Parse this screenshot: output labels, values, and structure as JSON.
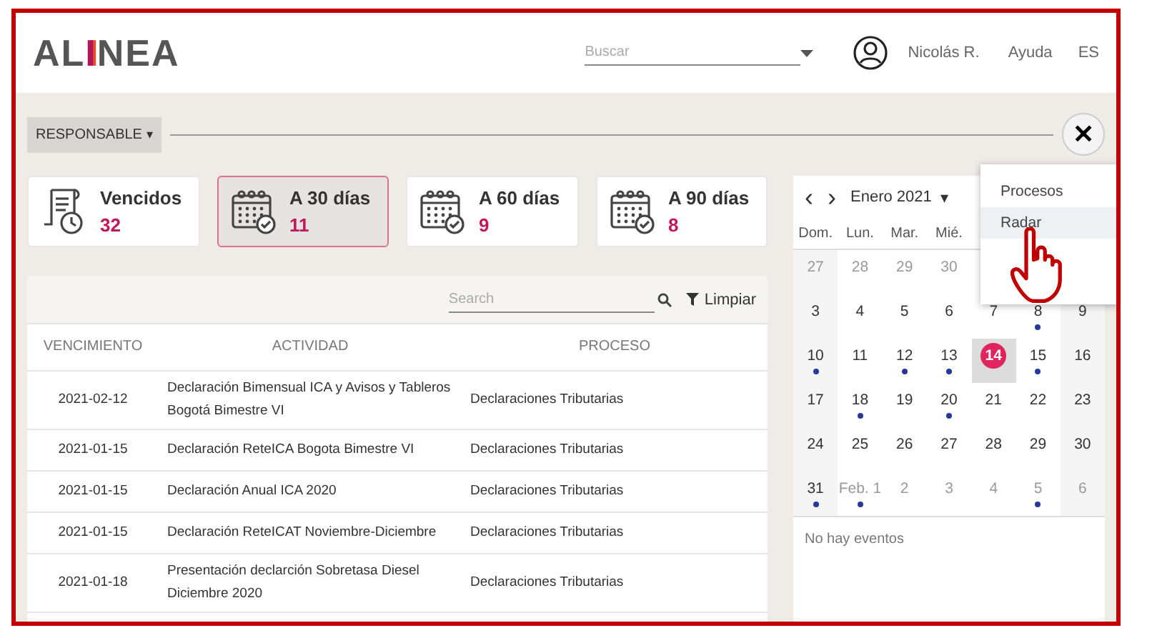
{
  "header": {
    "logo": {
      "before": "AL",
      "mark": "I",
      "after": "NEA"
    },
    "search": {
      "placeholder": "Buscar"
    },
    "user": "Nicolás R.",
    "help": "Ayuda",
    "language": "ES"
  },
  "toolbar": {
    "filter": "RESPONSABLE",
    "filter_caret": "▾",
    "close": "✕"
  },
  "cards": [
    {
      "kind": "overdue",
      "label": "Vencidos",
      "count": "32",
      "selected": false
    },
    {
      "kind": "calendar",
      "label": "A 30 días",
      "count": "11",
      "selected": true
    },
    {
      "kind": "calendar",
      "label": "A 60 días",
      "count": "9",
      "selected": false
    },
    {
      "kind": "calendar",
      "label": "A 90 días",
      "count": "8",
      "selected": false
    }
  ],
  "table": {
    "search": {
      "placeholder": "Search"
    },
    "clear": "Limpiar",
    "columns": [
      "VENCIMIENTO",
      "ACTIVIDAD",
      "PROCESO"
    ],
    "rows": [
      [
        "2021-02-12",
        "Declaración Bimensual ICA y Avisos y Tableros Bogotá Bimestre VI",
        "Declaraciones Tributarias"
      ],
      [
        "2021-01-15",
        "Declaración ReteICA Bogota Bimestre VI",
        "Declaraciones Tributarias"
      ],
      [
        "2021-01-15",
        "Declaración Anual ICA 2020",
        "Declaraciones Tributarias"
      ],
      [
        "2021-01-15",
        "Declaración ReteICAT Noviembre-Diciembre",
        "Declaraciones Tributarias"
      ],
      [
        "2021-01-18",
        "Presentación declarción Sobretasa Diesel Diciembre 2020",
        "Declaraciones Tributarias"
      ]
    ]
  },
  "calendar": {
    "prev": "‹",
    "next": "›",
    "month": "Enero 2021",
    "month_caret": "▾",
    "weekdays": [
      "Dom.",
      "Lun.",
      "Mar.",
      "Mié."
    ],
    "weeks": [
      [
        {
          "day": "27",
          "muted": true,
          "dot": false,
          "selected": false
        },
        {
          "day": "28",
          "muted": true,
          "dot": false,
          "selected": false
        },
        {
          "day": "29",
          "muted": true,
          "dot": false,
          "selected": false
        },
        {
          "day": "30",
          "muted": true,
          "dot": false,
          "selected": false
        }
      ],
      [
        {
          "day": "3",
          "muted": false,
          "dot": false,
          "selected": false
        },
        {
          "day": "4",
          "muted": false,
          "dot": false,
          "selected": false
        },
        {
          "day": "5",
          "muted": false,
          "dot": false,
          "selected": false
        },
        {
          "day": "6",
          "muted": false,
          "dot": false,
          "selected": false
        },
        {
          "day": "7",
          "muted": false,
          "dot": false,
          "selected": false
        },
        {
          "day": "8",
          "muted": false,
          "dot": true,
          "selected": false
        },
        {
          "day": "9",
          "muted": false,
          "dot": false,
          "selected": false
        }
      ],
      [
        {
          "day": "10",
          "muted": false,
          "dot": true,
          "selected": false
        },
        {
          "day": "11",
          "muted": false,
          "dot": false,
          "selected": false
        },
        {
          "day": "12",
          "muted": false,
          "dot": true,
          "selected": false
        },
        {
          "day": "13",
          "muted": false,
          "dot": true,
          "selected": false
        },
        {
          "day": "14",
          "muted": false,
          "dot": false,
          "selected": true
        },
        {
          "day": "15",
          "muted": false,
          "dot": true,
          "selected": false
        },
        {
          "day": "16",
          "muted": false,
          "dot": false,
          "selected": false
        }
      ],
      [
        {
          "day": "17",
          "muted": false,
          "dot": false,
          "selected": false
        },
        {
          "day": "18",
          "muted": false,
          "dot": true,
          "selected": false
        },
        {
          "day": "19",
          "muted": false,
          "dot": false,
          "selected": false
        },
        {
          "day": "20",
          "muted": false,
          "dot": true,
          "selected": false
        },
        {
          "day": "21",
          "muted": false,
          "dot": false,
          "selected": false
        },
        {
          "day": "22",
          "muted": false,
          "dot": false,
          "selected": false
        },
        {
          "day": "23",
          "muted": false,
          "dot": false,
          "selected": false
        }
      ],
      [
        {
          "day": "24",
          "muted": false,
          "dot": false,
          "selected": false
        },
        {
          "day": "25",
          "muted": false,
          "dot": false,
          "selected": false
        },
        {
          "day": "26",
          "muted": false,
          "dot": false,
          "selected": false
        },
        {
          "day": "27",
          "muted": false,
          "dot": false,
          "selected": false
        },
        {
          "day": "28",
          "muted": false,
          "dot": false,
          "selected": false
        },
        {
          "day": "29",
          "muted": false,
          "dot": false,
          "selected": false
        },
        {
          "day": "30",
          "muted": false,
          "dot": false,
          "selected": false
        }
      ],
      [
        {
          "day": "31",
          "muted": false,
          "dot": true,
          "selected": false
        },
        {
          "day": "Feb. 1",
          "muted": true,
          "dot": true,
          "selected": false
        },
        {
          "day": "2",
          "muted": true,
          "dot": false,
          "selected": false
        },
        {
          "day": "3",
          "muted": true,
          "dot": false,
          "selected": false
        },
        {
          "day": "4",
          "muted": true,
          "dot": false,
          "selected": false
        },
        {
          "day": "5",
          "muted": true,
          "dot": true,
          "selected": false
        },
        {
          "day": "6",
          "muted": true,
          "dot": false,
          "selected": false
        }
      ]
    ],
    "empty": "No hay eventos"
  },
  "menu": {
    "items": [
      {
        "label": "Procesos",
        "selected": false
      },
      {
        "label": "Radar",
        "selected": true
      }
    ]
  }
}
